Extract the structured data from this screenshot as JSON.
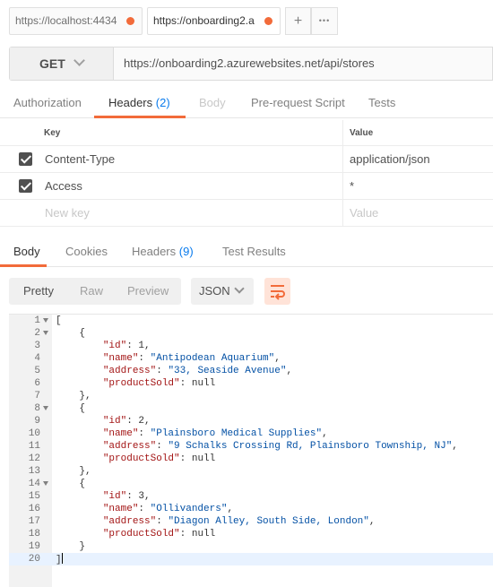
{
  "request_tabs": [
    {
      "label": "https://localhost:4434",
      "active": false,
      "dirty": true
    },
    {
      "label": "https://onboarding2.a",
      "active": true,
      "dirty": true
    }
  ],
  "tab_controls": {
    "add_label": "+",
    "more_label": "•••"
  },
  "request": {
    "method": "GET",
    "url": "https://onboarding2.azurewebsites.net/api/stores"
  },
  "request_tabs_nav": [
    {
      "label": "Authorization",
      "count": "",
      "state": "normal"
    },
    {
      "label": "Headers",
      "count": "(2)",
      "state": "active"
    },
    {
      "label": "Body",
      "count": "",
      "state": "disabled"
    },
    {
      "label": "Pre-request Script",
      "count": "",
      "state": "normal"
    },
    {
      "label": "Tests",
      "count": "",
      "state": "normal"
    }
  ],
  "headers_table": {
    "columns": [
      "Key",
      "Value"
    ],
    "rows": [
      {
        "key": "Content-Type",
        "value": "application/json",
        "checked": true
      },
      {
        "key": "Access",
        "value": "*",
        "checked": true
      }
    ],
    "placeholder": {
      "key": "New key",
      "value": "Value"
    }
  },
  "response_tabs": [
    {
      "label": "Body",
      "count": "",
      "state": "active"
    },
    {
      "label": "Cookies",
      "count": "",
      "state": "normal"
    },
    {
      "label": "Headers",
      "count": "(9)",
      "state": "normal"
    },
    {
      "label": "Test Results",
      "count": "",
      "state": "normal"
    }
  ],
  "view_modes": [
    {
      "label": "Pretty",
      "active": true
    },
    {
      "label": "Raw",
      "active": false
    },
    {
      "label": "Preview",
      "active": false
    }
  ],
  "format": "JSON",
  "icons": {
    "wrap": "wrap-lines-icon",
    "format_chevron": "chevron-down-icon",
    "method_chevron": "chevron-down-icon"
  },
  "colors": {
    "accent": "#f26b3a",
    "count_blue": "#097bed",
    "json_key": "#a31515",
    "json_string": "#0451a5"
  },
  "response_body": [
    {
      "n": "1",
      "fold": true,
      "text": "["
    },
    {
      "n": "2",
      "fold": true,
      "text": "    {"
    },
    {
      "n": "3",
      "fold": false,
      "key": "\"id\"",
      "sep": ": ",
      "val": "1",
      "vtype": "p",
      "tail": ","
    },
    {
      "n": "4",
      "fold": false,
      "key": "\"name\"",
      "sep": ": ",
      "val": "\"Antipodean Aquarium\"",
      "vtype": "s",
      "tail": ","
    },
    {
      "n": "5",
      "fold": false,
      "key": "\"address\"",
      "sep": ": ",
      "val": "\"33, Seaside Avenue\"",
      "vtype": "s",
      "tail": ","
    },
    {
      "n": "6",
      "fold": false,
      "key": "\"productSold\"",
      "sep": ": ",
      "val": "null",
      "vtype": "p",
      "tail": ""
    },
    {
      "n": "7",
      "fold": false,
      "text": "    },"
    },
    {
      "n": "8",
      "fold": true,
      "text": "    {"
    },
    {
      "n": "9",
      "fold": false,
      "key": "\"id\"",
      "sep": ": ",
      "val": "2",
      "vtype": "p",
      "tail": ","
    },
    {
      "n": "10",
      "fold": false,
      "key": "\"name\"",
      "sep": ": ",
      "val": "\"Plainsboro Medical Supplies\"",
      "vtype": "s",
      "tail": ","
    },
    {
      "n": "11",
      "fold": false,
      "key": "\"address\"",
      "sep": ": ",
      "val": "\"9 Schalks Crossing Rd, Plainsboro Township, NJ\"",
      "vtype": "s",
      "tail": ","
    },
    {
      "n": "12",
      "fold": false,
      "key": "\"productSold\"",
      "sep": ": ",
      "val": "null",
      "vtype": "p",
      "tail": ""
    },
    {
      "n": "13",
      "fold": false,
      "text": "    },"
    },
    {
      "n": "14",
      "fold": true,
      "text": "    {"
    },
    {
      "n": "15",
      "fold": false,
      "key": "\"id\"",
      "sep": ": ",
      "val": "3",
      "vtype": "p",
      "tail": ","
    },
    {
      "n": "16",
      "fold": false,
      "key": "\"name\"",
      "sep": ": ",
      "val": "\"Ollivanders\"",
      "vtype": "s",
      "tail": ","
    },
    {
      "n": "17",
      "fold": false,
      "key": "\"address\"",
      "sep": ": ",
      "val": "\"Diagon Alley, South Side, London\"",
      "vtype": "s",
      "tail": ","
    },
    {
      "n": "18",
      "fold": false,
      "key": "\"productSold\"",
      "sep": ": ",
      "val": "null",
      "vtype": "p",
      "tail": ""
    },
    {
      "n": "19",
      "fold": false,
      "text": "    }"
    },
    {
      "n": "20",
      "fold": false,
      "text": "]",
      "current": true
    }
  ]
}
